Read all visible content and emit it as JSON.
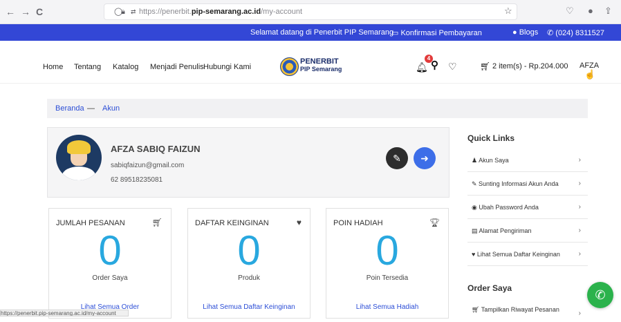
{
  "browser": {
    "back_icon": "←",
    "forward_icon": "→",
    "reload_icon": "C",
    "url_prefix": "https://penerbit.",
    "url_domain": "pip-semarang.ac.id",
    "url_path": "/my-account",
    "status_text": "https://penerbit.pip-semarang.ac.id/my-account"
  },
  "topbar": {
    "welcome": "Selamat datang di Penerbit PIP Semarang",
    "confirm": "Konfirmasi Pembayaran",
    "blogs": "Blogs",
    "phone": "(024) 8311527"
  },
  "header": {
    "menu": [
      "Home",
      "Tentang",
      "Katalog",
      "Menjadi Penulis",
      "Hubungi Kami"
    ],
    "logo_line1": "PENERBIT",
    "logo_line2": "PIP Semarang",
    "notif_count": "4",
    "cart": "2 item(s) - Rp.204.000",
    "user": "AFZA"
  },
  "breadcrumb": {
    "home": "Beranda",
    "separator": "—",
    "current": "Akun"
  },
  "profile": {
    "name": "AFZA SABIQ FAIZUN",
    "email": "sabiqfaizun@gmail.com",
    "phone": "62 89518235081"
  },
  "stats": [
    {
      "title": "JUMLAH PESANAN",
      "value": "0",
      "subtitle": "Order Saya",
      "link": "Lihat Semua Order",
      "icon": "cart-icon"
    },
    {
      "title": "DAFTAR KEINGINAN",
      "value": "0",
      "subtitle": "Produk",
      "link": "Lihat Semua Daftar Keinginan",
      "icon": "heart-icon"
    },
    {
      "title": "POIN HADIAH",
      "value": "0",
      "subtitle": "Poin Tersedia",
      "link": "Lihat Semua Hadiah",
      "icon": "trophy-icon"
    }
  ],
  "sidebar": {
    "quick_links_title": "Quick Links",
    "quick_links": [
      "Akun Saya",
      "Sunting Informasi Akun Anda",
      "Ubah Password Anda",
      "Alamat Pengiriman",
      "Lihat Semua Daftar Keinginan"
    ],
    "order_title": "Order Saya",
    "order_links": [
      "Tampilkan Riwayat Pesanan"
    ]
  },
  "colors": {
    "brand_blue": "#3347d6",
    "stat_blue": "#29a8df",
    "link_blue": "#2c4ed6",
    "whatsapp_green": "#2bb24c"
  }
}
